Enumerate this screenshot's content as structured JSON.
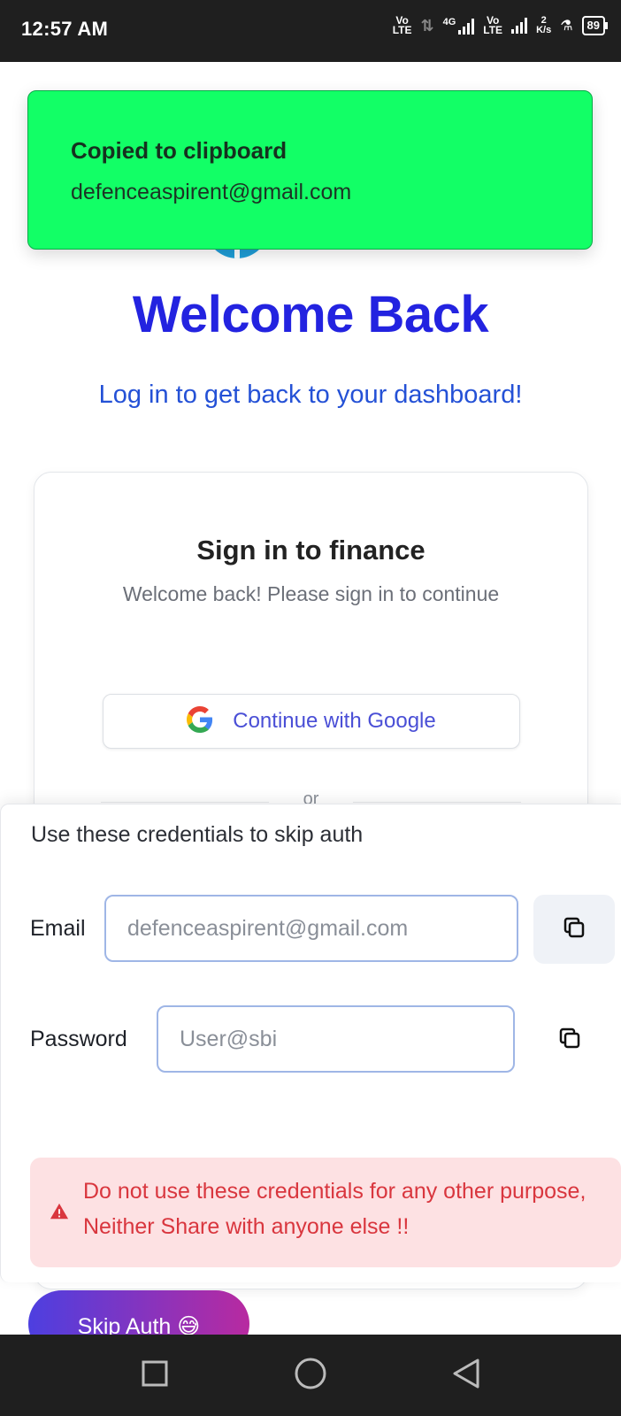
{
  "status_bar": {
    "time": "12:57 AM",
    "net1": "Vo\nLTE",
    "net2": "4G",
    "net3": "Vo\nLTE",
    "speed": "2\nK/s",
    "battery": "89"
  },
  "page": {
    "title": "Welcome Back",
    "subtitle": "Log in to get back to your dashboard!"
  },
  "card": {
    "title": "Sign in to finance",
    "subtitle": "Welcome back! Please sign in to continue",
    "google_button": "Continue with Google",
    "divider_text": "or"
  },
  "credentials": {
    "heading": "Use these credentials to skip auth",
    "email_label": "Email",
    "email_value": "defenceaspirent@gmail.com",
    "password_label": "Password",
    "password_value": "User@sbi",
    "warning": "Do not use these credentials for any other purpose, Neither Share with anyone else !!"
  },
  "skip_button": "Skip Auth 😅",
  "toast": {
    "title": "Copied to clipboard",
    "message": "defenceaspirent@gmail.com"
  },
  "colors": {
    "title_blue": "#2323e0",
    "toast_green": "#12ff66",
    "warning_bg": "#fde1e3",
    "warning_text": "#d9363e"
  },
  "icons": [
    "google-icon",
    "copy-icon",
    "warning-icon",
    "recents-icon",
    "home-icon",
    "back-icon"
  ]
}
